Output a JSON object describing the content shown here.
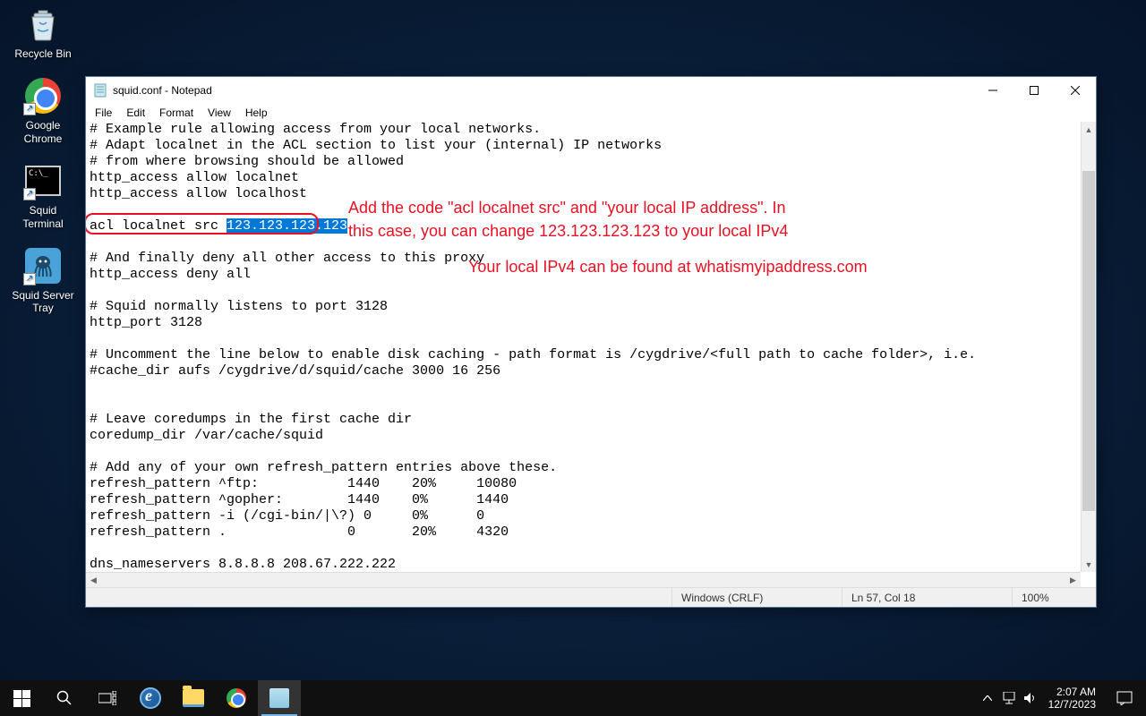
{
  "desktop": {
    "icons": [
      {
        "label": "Recycle Bin"
      },
      {
        "label": "Google Chrome"
      },
      {
        "label": "Squid Terminal"
      },
      {
        "label": "Squid Server Tray"
      }
    ]
  },
  "window": {
    "title": "squid.conf - Notepad",
    "menu": {
      "file": "File",
      "edit": "Edit",
      "format": "Format",
      "view": "View",
      "help": "Help"
    },
    "content_lines": [
      "# Example rule allowing access from your local networks.",
      "# Adapt localnet in the ACL section to list your (internal) IP networks",
      "# from where browsing should be allowed",
      "http_access allow localnet",
      "http_access allow localhost",
      "",
      "acl localnet src ",
      "",
      "# And finally deny all other access to this proxy",
      "http_access deny all",
      "",
      "# Squid normally listens to port 3128",
      "http_port 3128",
      "",
      "# Uncomment the line below to enable disk caching - path format is /cygdrive/<full path to cache folder>, i.e.",
      "#cache_dir aufs /cygdrive/d/squid/cache 3000 16 256",
      "",
      "",
      "# Leave coredumps in the first cache dir",
      "coredump_dir /var/cache/squid",
      "",
      "# Add any of your own refresh_pattern entries above these.",
      "refresh_pattern ^ftp:           1440    20%     10080",
      "refresh_pattern ^gopher:        1440    0%      1440",
      "refresh_pattern -i (/cgi-bin/|\\?) 0     0%      0",
      "refresh_pattern .               0       20%     4320",
      "",
      "dns_nameservers 8.8.8.8 208.67.222.222"
    ],
    "selected_text": "123.123.123.123",
    "status": {
      "encoding": "Windows (CRLF)",
      "pos": "Ln 57, Col 18",
      "zoom": "100%"
    }
  },
  "annotations": {
    "line1": "Add the code \"acl localnet src\" and \"your local IP address\". In",
    "line2": "this case, you can change 123.123.123.123 to your local IPv4",
    "line3": "Your local IPv4 can be found at whatismyipaddress.com"
  },
  "taskbar": {
    "clock_time": "2:07 AM",
    "clock_date": "12/7/2023"
  }
}
